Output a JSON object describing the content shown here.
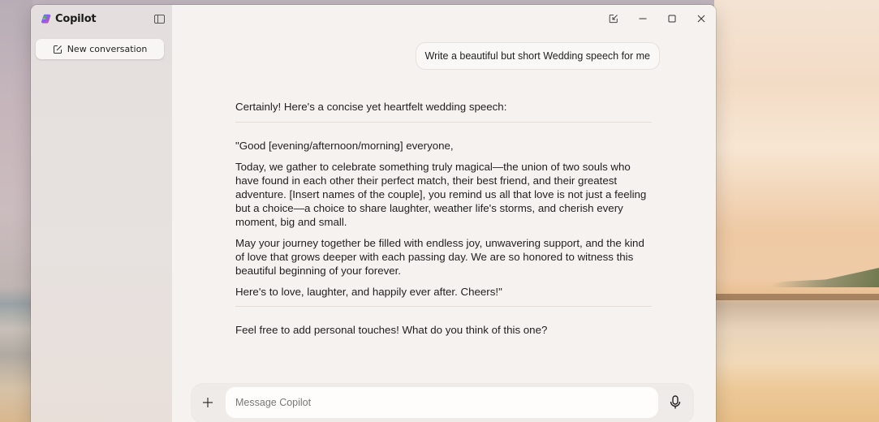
{
  "app": {
    "name": "Copilot",
    "brand_colors": [
      "#f26b3a",
      "#8b5cf6",
      "#22c55e",
      "#3b82f6",
      "#facc15",
      "#ec4899"
    ]
  },
  "sidebar": {
    "toggle_icon": "sidebar-panel-icon",
    "new_conversation_label": "New conversation",
    "new_conversation_icon": "compose-icon"
  },
  "titlebar": {
    "buttons": [
      {
        "name": "restore-to-compact",
        "icon": "arrow-to-corner-icon"
      },
      {
        "name": "minimize",
        "icon": "minimize-icon"
      },
      {
        "name": "maximize",
        "icon": "maximize-icon"
      },
      {
        "name": "close",
        "icon": "close-icon"
      }
    ]
  },
  "conversation": {
    "user_message": "Write a beautiful but short Wedding speech for me",
    "assistant": {
      "intro": "Certainly! Here's a concise yet heartfelt wedding speech:",
      "paragraphs": [
        "\"Good [evening/afternoon/morning] everyone,",
        "Today, we gather to celebrate something truly magical—the union of two souls who have found in each other their perfect match, their best friend, and their greatest adventure. [Insert names of the couple], you remind us all that love is not just a feeling but a choice—a choice to share laughter, weather life's storms, and cherish every moment, big and small.",
        "May your journey together be filled with endless joy, unwavering support, and the kind of love that grows deeper with each passing day. We are so honored to witness this beautiful beginning of your forever.",
        "Here's to love, laughter, and happily ever after. Cheers!\""
      ],
      "outro": "Feel free to add personal touches! What do you think of this one?"
    }
  },
  "composer": {
    "placeholder": "Message Copilot",
    "value": "",
    "add_icon": "plus-icon",
    "mic_icon": "microphone-icon"
  }
}
